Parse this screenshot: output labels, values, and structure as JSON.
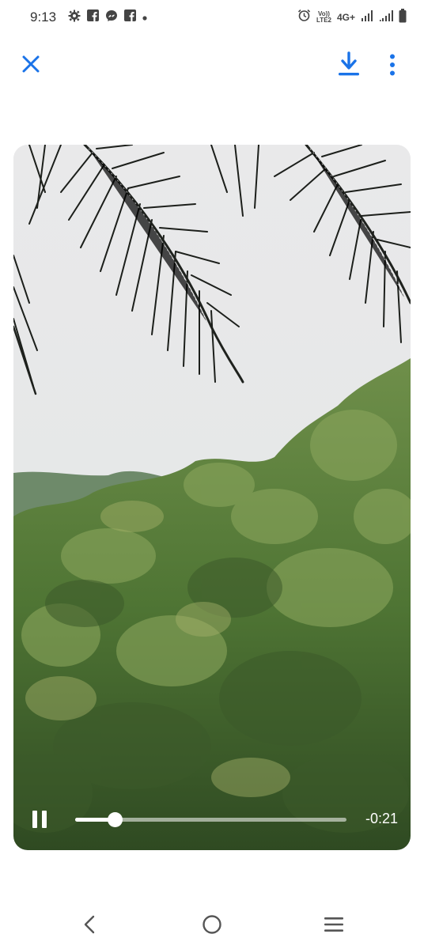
{
  "status_bar": {
    "time": "9:13",
    "network": "4G+",
    "volte_top": "Vo))",
    "volte_bottom": "LTE2",
    "left_icons": [
      "settings-icon",
      "facebook-icon",
      "messenger-icon",
      "facebook-icon",
      "notification-dot-icon"
    ],
    "right_icons": [
      "alarm-icon",
      "volte-icon",
      "signal-icon",
      "signal-icon",
      "battery-icon"
    ]
  },
  "top_bar": {
    "icons": [
      "close-icon",
      "download-icon",
      "more-vert-icon"
    ],
    "accent_color": "#1a73e8"
  },
  "video": {
    "remaining_time": "-0:21",
    "progress": 0.145,
    "state": "playing"
  },
  "nav_bar": {
    "icons": [
      "back-icon",
      "home-icon",
      "recents-icon"
    ]
  }
}
